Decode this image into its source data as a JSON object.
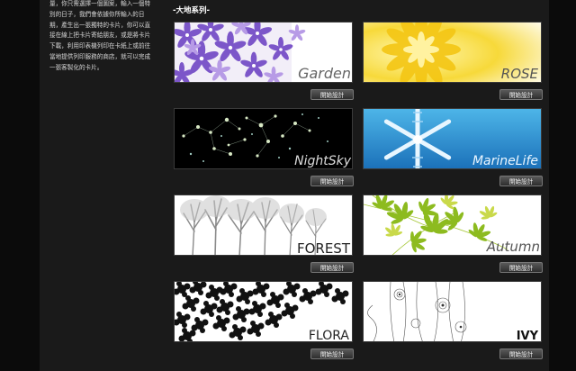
{
  "sidebar": {
    "lines": [
      "量，你只需選擇一個圖案，輸入一個特",
      "別的日子，我們會依據你所輸入的日",
      "期，產生出一張獨特的卡片，你可以直",
      "接在線上把卡片寄給朋友，或是將卡片",
      "下載，利用印表機列印在卡紙上或前往",
      "當地提供列印服務的商店，就可以完成",
      "一張客製化的卡片。"
    ]
  },
  "section": {
    "title": "-大地系列-"
  },
  "cards": [
    {
      "title": "Garden",
      "button": "開始設計"
    },
    {
      "title": "ROSE",
      "button": "開始設計"
    },
    {
      "title": "NightSky",
      "button": "開始設計"
    },
    {
      "title": "MarineLife",
      "button": "開始設計"
    },
    {
      "title": "FOREST",
      "button": "開始設計"
    },
    {
      "title": "Autumn",
      "button": "開始設計"
    },
    {
      "title": "FLORA",
      "button": "開始設計"
    },
    {
      "title": "IVY",
      "button": "開始設計"
    }
  ],
  "colors": {
    "background": "#0e0e0e",
    "panel": "#1a1a1a",
    "text": "#d8d8d8",
    "button": "#3c3c3c"
  }
}
